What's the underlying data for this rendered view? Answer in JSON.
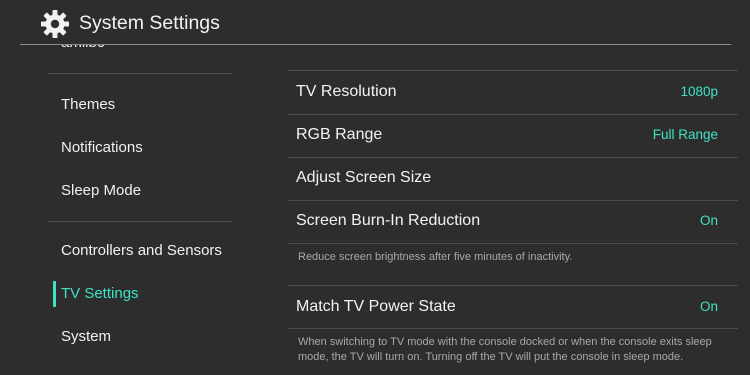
{
  "header": {
    "title": "System Settings",
    "icon": "gear-icon"
  },
  "sidebar": {
    "cut_item": "amiibo",
    "items": [
      {
        "label": "Themes"
      },
      {
        "label": "Notifications"
      },
      {
        "label": "Sleep Mode"
      },
      {
        "label": "Controllers and Sensors"
      },
      {
        "label": "TV Settings",
        "active": true
      },
      {
        "label": "System"
      }
    ]
  },
  "main": {
    "rows": [
      {
        "label": "TV Resolution",
        "value": "1080p"
      },
      {
        "label": "RGB Range",
        "value": "Full Range"
      },
      {
        "label": "Adjust Screen Size",
        "value": ""
      },
      {
        "label": "Screen Burn-In Reduction",
        "value": "On",
        "description": "Reduce screen brightness after five minutes of inactivity."
      },
      {
        "label": "Match TV Power State",
        "value": "On",
        "description": "When switching to TV mode with the console docked or when the console exits sleep mode, the TV will turn on. Turning off the TV will put the console in sleep mode."
      }
    ]
  },
  "colors": {
    "background": "#2d2d2d",
    "accent": "#3fe2c2",
    "text": "#f3f3f3",
    "secondary_text": "#a8a8a8",
    "divider": "#4b4b4b"
  }
}
